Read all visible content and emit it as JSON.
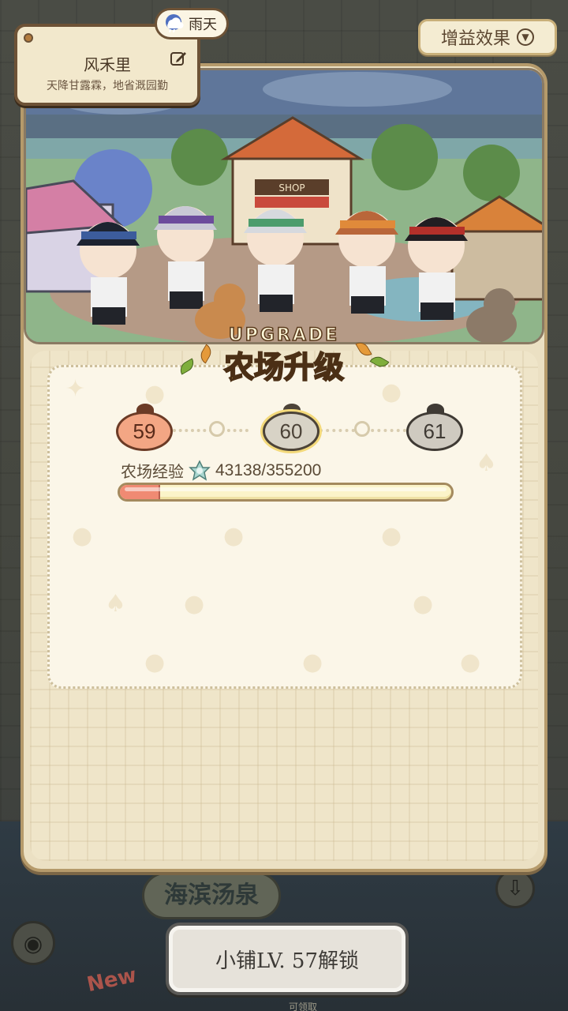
{
  "weather": {
    "label": "雨天",
    "icon": "rain-cloud-icon"
  },
  "farm": {
    "name": "风禾里",
    "motto": "天降甘露霖，地省溉园勤"
  },
  "boost_button": {
    "label": "增益效果"
  },
  "banner": {
    "en": "UPGRADE",
    "cn": "农场升级"
  },
  "levels": [
    {
      "value": "59",
      "state": "done"
    },
    {
      "value": "60",
      "state": "current"
    },
    {
      "value": "61",
      "state": "next"
    }
  ],
  "experience": {
    "label": "农场经验",
    "value_text": "43138/355200",
    "current": 43138,
    "max": 355200
  },
  "unlock_button": {
    "label": "小铺LV. 57解锁"
  },
  "background": {
    "location_sign": "海滨汤泉",
    "new_badge": "New",
    "claim_hint": "可领取"
  },
  "colors": {
    "panel": "#ebe0c3",
    "exp_fill": "#f08a73",
    "accent_gold": "#f7d24a"
  }
}
